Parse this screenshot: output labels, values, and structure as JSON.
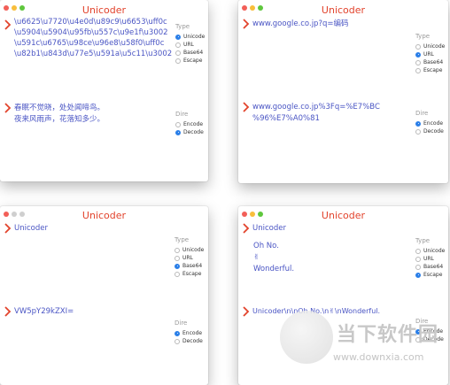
{
  "app_title": "Unicoder",
  "labels": {
    "type_header": "Type",
    "dire_header": "Dire",
    "types": [
      "Unicode",
      "URL",
      "Base64",
      "Escape"
    ],
    "dires": [
      "Encode",
      "Decode"
    ]
  },
  "windows": [
    {
      "input": "\\u6625\\u7720\\u4e0d\\u89c9\\u6653\\uff0c\n\\u5904\\u5904\\u95fb\\u557c\\u9e1f\\u3002\n\\u591c\\u6765\\u98ce\\u96e8\\u58f0\\uff0c\n\\u82b1\\u843d\\u77e5\\u591a\\u5c11\\u3002",
      "output": "春眠不觉晓，处处闻啼鸟。\n夜来风雨声，花落知多少。",
      "selected_type": "Unicode",
      "selected_dire": "Decode"
    },
    {
      "input": "www.google.co.jp?q=编码",
      "output": "www.google.co.jp%3Fq=%E7%BC\n%96%E7%A0%81",
      "selected_type": "URL",
      "selected_dire": "Encode"
    },
    {
      "input": "Unicoder",
      "output": "VW5pY29kZXI=",
      "selected_type": "Base64",
      "selected_dire": "Encode"
    },
    {
      "input": "Oh No.\n✌\nWonderful.",
      "output": "Unicoder\\n\\nOh No.\\n✌\\nWonderful.",
      "selected_type": "Escape",
      "selected_dire": "Encode"
    }
  ],
  "watermark": {
    "text": "当下软件园",
    "url": "www.downxia.com"
  }
}
